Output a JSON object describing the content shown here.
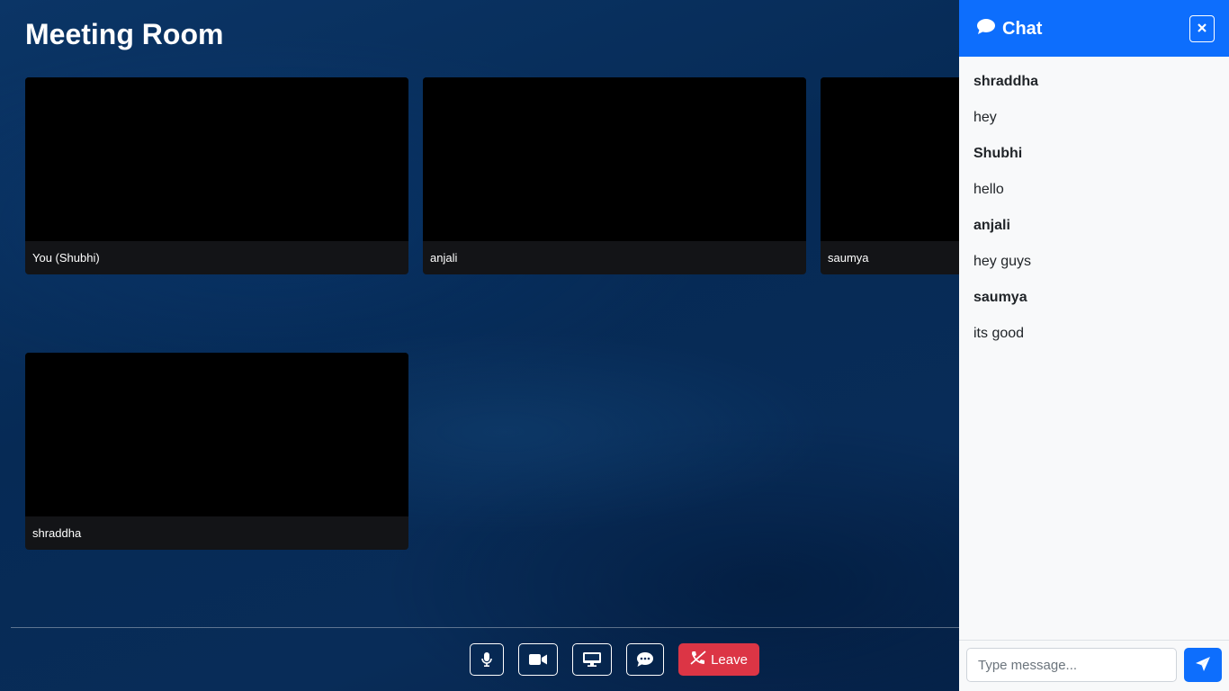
{
  "meeting": {
    "title": "Meeting Room",
    "participants": [
      {
        "name": "You (Shubhi)"
      },
      {
        "name": "anjali"
      },
      {
        "name": "saumya"
      },
      {
        "name": "shraddha"
      }
    ]
  },
  "controls": {
    "mic_icon": "microphone-icon",
    "camera_icon": "video-camera-icon",
    "screen_icon": "desktop-monitor-icon",
    "chat_icon": "chat-bubble-icon",
    "leave_label": "Leave",
    "leave_icon": "phone-hangup-icon",
    "leave_color": "#dc3545"
  },
  "chat": {
    "title": "Chat",
    "header_color": "#0d6efd",
    "messages": [
      {
        "sender": "shraddha",
        "text": "hey"
      },
      {
        "sender": "Shubhi",
        "text": "hello"
      },
      {
        "sender": "anjali",
        "text": "hey guys"
      },
      {
        "sender": "saumya",
        "text": "its good"
      }
    ],
    "input": {
      "value": "",
      "placeholder": "Type message..."
    },
    "send_icon": "paper-plane-icon"
  }
}
